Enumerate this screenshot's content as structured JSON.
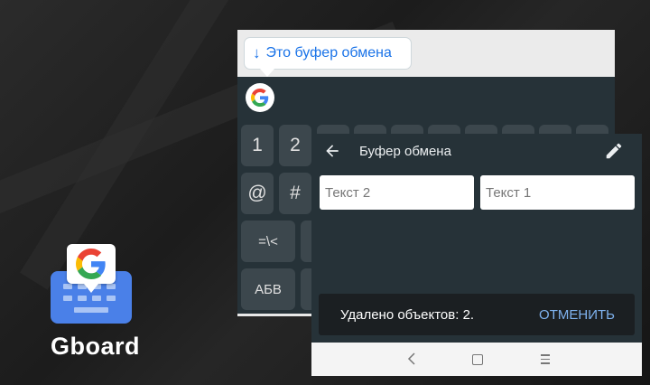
{
  "brand": {
    "name": "Gboard",
    "blue": "#4a80e8"
  },
  "keyboard": {
    "suggestion_chip": "Это буфер обмена",
    "arrow_icon": "arrow-down-icon",
    "google_icon": "google-g-icon",
    "row1": [
      "1",
      "2"
    ],
    "row2": [
      "@",
      "#"
    ],
    "row3": [
      "=\\<",
      "?"
    ],
    "row4": [
      "АБВ"
    ]
  },
  "clipboard": {
    "title": "Буфер обмена",
    "items": [
      "Текст 2",
      "Текст 1"
    ],
    "snackbar": {
      "message": "Удалено объектов: 2.",
      "action": "ОТМЕНИТЬ",
      "action_color": "#7fb3f0"
    }
  },
  "colors": {
    "keyboard_bg": "#263238",
    "key_bg": "#3c474d",
    "accent": "#1a73e8"
  }
}
